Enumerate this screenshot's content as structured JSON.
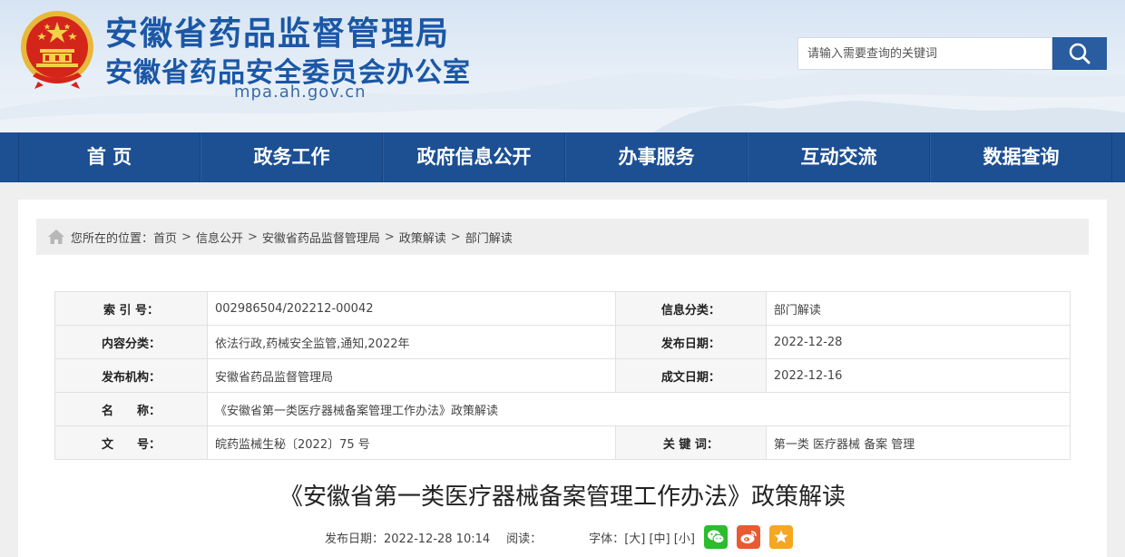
{
  "header": {
    "title_line1": "安徽省药品监督管理局",
    "title_line2": "安徽省药品安全委员会办公室",
    "domain": "mpa.ah.gov.cn",
    "search_placeholder": "请输入需要查询的关键词"
  },
  "nav": [
    "首 页",
    "政务工作",
    "政府信息公开",
    "办事服务",
    "互动交流",
    "数据查询"
  ],
  "breadcrumb": {
    "prefix": "您所在的位置：",
    "items": [
      "首页",
      "信息公开",
      "安徽省药品监督管理局",
      "政策解读",
      "部门解读"
    ],
    "separator": ">"
  },
  "info": {
    "index_label": "索 引 号：",
    "index_value": "002986504/202212-00042",
    "category_label": "信息分类：",
    "category_value": "部门解读",
    "content_label": "内容分类：",
    "content_value": "依法行政,药械安全监管,通知,2022年",
    "publish_label": "发布日期：",
    "publish_value": "2022-12-28",
    "org_label": "发布机构：",
    "org_value": "安徽省药品监督管理局",
    "created_label": "成文日期：",
    "created_value": "2022-12-16",
    "name_label": "名　　称：",
    "name_value": "《安徽省第一类医疗器械备案管理工作办法》政策解读",
    "docno_label": "文　　号：",
    "docno_value": "皖药监械生秘〔2022〕75 号",
    "keywords_label": "关 键 词：",
    "keywords_value": "第一类 医疗器械 备案 管理"
  },
  "article": {
    "title": "《安徽省第一类医疗器械备案管理工作办法》政策解读",
    "date_text": "发布日期：2022-12-28 10:14",
    "views_text": "阅读：",
    "font_label": "字体：",
    "font_large": "[大]",
    "font_medium": "[中]",
    "font_small": "[小]"
  },
  "colors": {
    "nav_bg": "#1d4f93",
    "title_blue": "#1b57a6",
    "wechat": "#2dbc2d",
    "weibo": "#e95a33",
    "favorite": "#f5a623"
  }
}
